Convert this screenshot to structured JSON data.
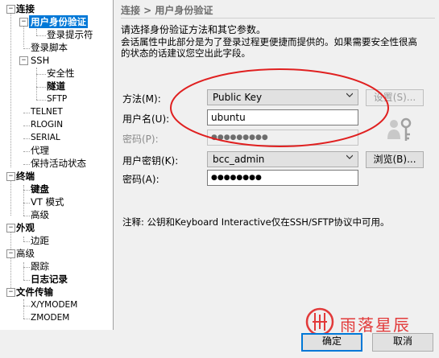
{
  "tree": {
    "connection": "连接",
    "auth": "用户身份验证",
    "login_prompt": "登录提示符",
    "login_script": "登录脚本",
    "ssh": "SSH",
    "security": "安全性",
    "tunnel": "隧道",
    "sftp": "SFTP",
    "telnet": "TELNET",
    "rlogin": "RLOGIN",
    "serial": "SERIAL",
    "proxy": "代理",
    "keepalive": "保持活动状态",
    "terminal": "终端",
    "keyboard": "键盘",
    "vt_mode": "VT 模式",
    "advanced": "高级",
    "appearance": "外观",
    "margin": "边距",
    "advanced2": "高级",
    "trace": "跟踪",
    "log": "日志记录",
    "file_transfer": "文件传输",
    "xymodem": "X/YMODEM",
    "zmodem": "ZMODEM"
  },
  "panel": {
    "breadcrumb": "连接 > 用户身份验证",
    "intro": "请选择身份验证方法和其它参数。",
    "desc_line1": "会话属性中此部分是为了登录过程更便捷而提供的。如果需要安全性很高",
    "desc_line2": "的状态的话建议您空出此字段。",
    "method_label": "方法(M):",
    "method_value": "Public Key",
    "settings_button": "设置(S)...",
    "username_label": "用户名(U):",
    "username_value": "ubuntu",
    "password_label_disabled": "密码(P):",
    "password_disabled_value": "●●●●●●●●●",
    "user_key_label": "用户密钥(K):",
    "user_key_value": "bcc_admin",
    "browse_button": "浏览(B)...",
    "passphrase_label": "密码(A):",
    "passphrase_value": "●●●●●●●●",
    "note": "注释: 公钥和Keyboard Interactive仅在SSH/SFTP协议中可用。"
  },
  "footer": {
    "ok_button": "确定",
    "cancel_button": "取消"
  },
  "watermark": {
    "text": "雨落星辰"
  },
  "colors": {
    "selection": "#0078d7",
    "annotation_ellipse": "#e02020",
    "watermark": "#e23a3a"
  }
}
